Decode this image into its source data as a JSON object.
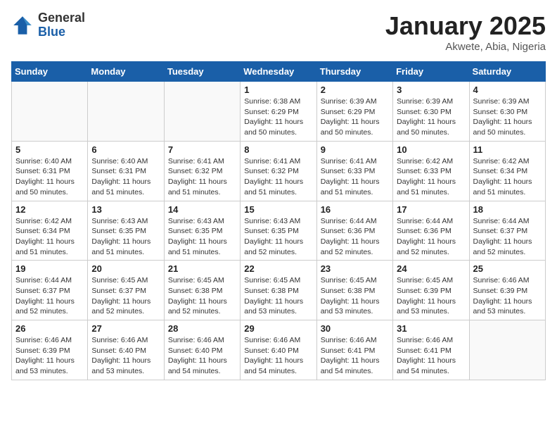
{
  "header": {
    "logo_general": "General",
    "logo_blue": "Blue",
    "title": "January 2025",
    "location": "Akwete, Abia, Nigeria"
  },
  "weekdays": [
    "Sunday",
    "Monday",
    "Tuesday",
    "Wednesday",
    "Thursday",
    "Friday",
    "Saturday"
  ],
  "weeks": [
    [
      {
        "day": "",
        "detail": ""
      },
      {
        "day": "",
        "detail": ""
      },
      {
        "day": "",
        "detail": ""
      },
      {
        "day": "1",
        "detail": "Sunrise: 6:38 AM\nSunset: 6:29 PM\nDaylight: 11 hours\nand 50 minutes."
      },
      {
        "day": "2",
        "detail": "Sunrise: 6:39 AM\nSunset: 6:29 PM\nDaylight: 11 hours\nand 50 minutes."
      },
      {
        "day": "3",
        "detail": "Sunrise: 6:39 AM\nSunset: 6:30 PM\nDaylight: 11 hours\nand 50 minutes."
      },
      {
        "day": "4",
        "detail": "Sunrise: 6:39 AM\nSunset: 6:30 PM\nDaylight: 11 hours\nand 50 minutes."
      }
    ],
    [
      {
        "day": "5",
        "detail": "Sunrise: 6:40 AM\nSunset: 6:31 PM\nDaylight: 11 hours\nand 50 minutes."
      },
      {
        "day": "6",
        "detail": "Sunrise: 6:40 AM\nSunset: 6:31 PM\nDaylight: 11 hours\nand 51 minutes."
      },
      {
        "day": "7",
        "detail": "Sunrise: 6:41 AM\nSunset: 6:32 PM\nDaylight: 11 hours\nand 51 minutes."
      },
      {
        "day": "8",
        "detail": "Sunrise: 6:41 AM\nSunset: 6:32 PM\nDaylight: 11 hours\nand 51 minutes."
      },
      {
        "day": "9",
        "detail": "Sunrise: 6:41 AM\nSunset: 6:33 PM\nDaylight: 11 hours\nand 51 minutes."
      },
      {
        "day": "10",
        "detail": "Sunrise: 6:42 AM\nSunset: 6:33 PM\nDaylight: 11 hours\nand 51 minutes."
      },
      {
        "day": "11",
        "detail": "Sunrise: 6:42 AM\nSunset: 6:34 PM\nDaylight: 11 hours\nand 51 minutes."
      }
    ],
    [
      {
        "day": "12",
        "detail": "Sunrise: 6:42 AM\nSunset: 6:34 PM\nDaylight: 11 hours\nand 51 minutes."
      },
      {
        "day": "13",
        "detail": "Sunrise: 6:43 AM\nSunset: 6:35 PM\nDaylight: 11 hours\nand 51 minutes."
      },
      {
        "day": "14",
        "detail": "Sunrise: 6:43 AM\nSunset: 6:35 PM\nDaylight: 11 hours\nand 51 minutes."
      },
      {
        "day": "15",
        "detail": "Sunrise: 6:43 AM\nSunset: 6:35 PM\nDaylight: 11 hours\nand 52 minutes."
      },
      {
        "day": "16",
        "detail": "Sunrise: 6:44 AM\nSunset: 6:36 PM\nDaylight: 11 hours\nand 52 minutes."
      },
      {
        "day": "17",
        "detail": "Sunrise: 6:44 AM\nSunset: 6:36 PM\nDaylight: 11 hours\nand 52 minutes."
      },
      {
        "day": "18",
        "detail": "Sunrise: 6:44 AM\nSunset: 6:37 PM\nDaylight: 11 hours\nand 52 minutes."
      }
    ],
    [
      {
        "day": "19",
        "detail": "Sunrise: 6:44 AM\nSunset: 6:37 PM\nDaylight: 11 hours\nand 52 minutes."
      },
      {
        "day": "20",
        "detail": "Sunrise: 6:45 AM\nSunset: 6:37 PM\nDaylight: 11 hours\nand 52 minutes."
      },
      {
        "day": "21",
        "detail": "Sunrise: 6:45 AM\nSunset: 6:38 PM\nDaylight: 11 hours\nand 52 minutes."
      },
      {
        "day": "22",
        "detail": "Sunrise: 6:45 AM\nSunset: 6:38 PM\nDaylight: 11 hours\nand 53 minutes."
      },
      {
        "day": "23",
        "detail": "Sunrise: 6:45 AM\nSunset: 6:38 PM\nDaylight: 11 hours\nand 53 minutes."
      },
      {
        "day": "24",
        "detail": "Sunrise: 6:45 AM\nSunset: 6:39 PM\nDaylight: 11 hours\nand 53 minutes."
      },
      {
        "day": "25",
        "detail": "Sunrise: 6:46 AM\nSunset: 6:39 PM\nDaylight: 11 hours\nand 53 minutes."
      }
    ],
    [
      {
        "day": "26",
        "detail": "Sunrise: 6:46 AM\nSunset: 6:39 PM\nDaylight: 11 hours\nand 53 minutes."
      },
      {
        "day": "27",
        "detail": "Sunrise: 6:46 AM\nSunset: 6:40 PM\nDaylight: 11 hours\nand 53 minutes."
      },
      {
        "day": "28",
        "detail": "Sunrise: 6:46 AM\nSunset: 6:40 PM\nDaylight: 11 hours\nand 54 minutes."
      },
      {
        "day": "29",
        "detail": "Sunrise: 6:46 AM\nSunset: 6:40 PM\nDaylight: 11 hours\nand 54 minutes."
      },
      {
        "day": "30",
        "detail": "Sunrise: 6:46 AM\nSunset: 6:41 PM\nDaylight: 11 hours\nand 54 minutes."
      },
      {
        "day": "31",
        "detail": "Sunrise: 6:46 AM\nSunset: 6:41 PM\nDaylight: 11 hours\nand 54 minutes."
      },
      {
        "day": "",
        "detail": ""
      }
    ]
  ]
}
